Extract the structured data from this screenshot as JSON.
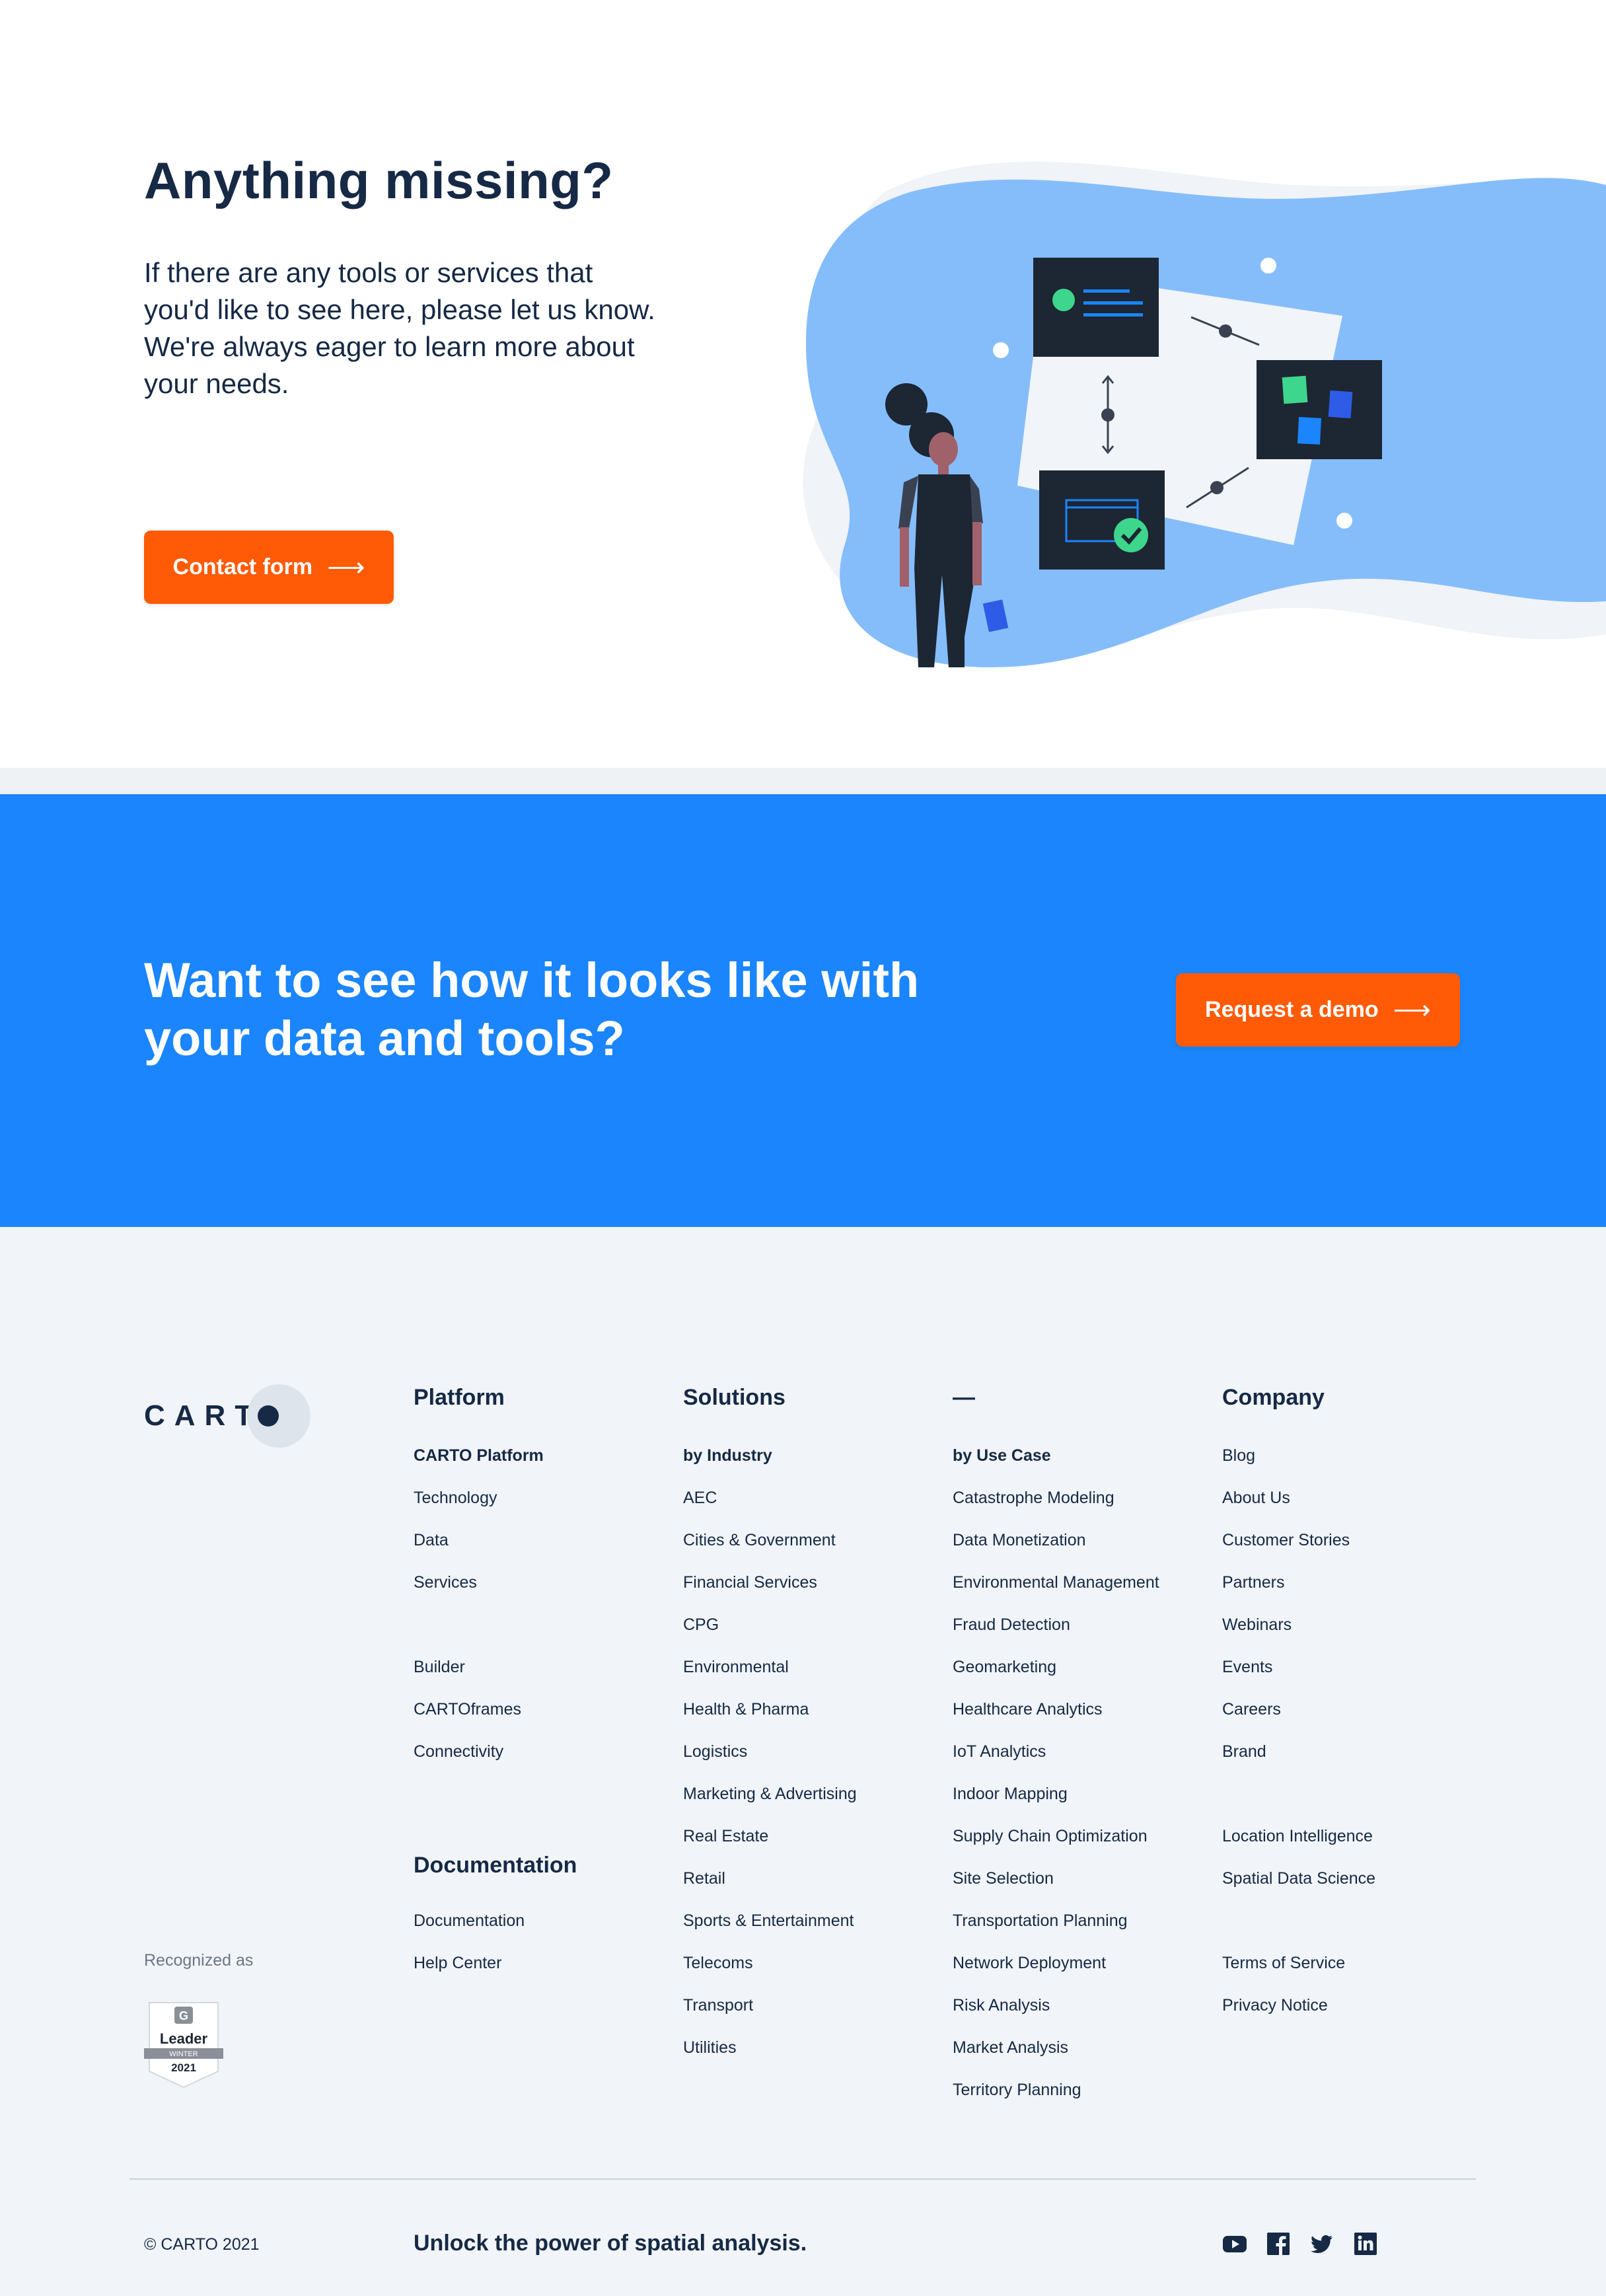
{
  "hero": {
    "title": "Anything missing?",
    "text": "If there are any tools or services that you'd like to see here, please let us know. We're always eager to learn more about your needs.",
    "button_label": "Contact form",
    "button_arrow": "⟶"
  },
  "cta": {
    "title": "Want to see how it looks like with your data and tools?",
    "button_label": "Request a demo",
    "button_arrow": "⟶"
  },
  "footer": {
    "logo_text": "CART",
    "columns": [
      {
        "heading": "Platform",
        "items": [
          "CARTO Platform",
          "Technology",
          "Data",
          "Services",
          "",
          "Builder",
          "CARTOframes",
          "Connectivity"
        ]
      },
      {
        "heading": "Solutions",
        "items": [
          "by Industry",
          "AEC",
          "Cities & Government",
          "Financial Services",
          "CPG",
          "Environmental",
          "Health & Pharma",
          "Logistics",
          "Marketing & Advertising",
          "Real Estate",
          "Retail",
          "Sports & Entertainment",
          "Telecoms",
          "Transport",
          "Utilities"
        ]
      },
      {
        "heading": "—",
        "items": [
          "by Use Case",
          "Catastrophe Modeling",
          "Data Monetization",
          "Environmental Management",
          "Fraud Detection",
          "Geomarketing",
          "Healthcare Analytics",
          "IoT Analytics",
          "Indoor Mapping",
          "Supply Chain Optimization",
          "Site Selection",
          "Transportation Planning",
          "Network Deployment",
          "Risk Analysis",
          "Market Analysis",
          "Territory Planning"
        ]
      },
      {
        "heading": "Company",
        "items": [
          "Blog",
          "About Us",
          "Customer Stories",
          "Partners",
          "Webinars",
          "Events",
          "Careers",
          "Brand",
          "",
          "Location Intelligence",
          "Spatial Data Science",
          "",
          "Terms of Service",
          "Privacy Notice"
        ]
      }
    ],
    "documentation": {
      "heading": "Documentation",
      "items": [
        "Documentation",
        "Help Center"
      ]
    },
    "recognized_label": "Recognized as",
    "badge": {
      "g2": "G",
      "title": "Leader",
      "season": "WINTER",
      "year": "2021"
    },
    "copyright": "© CARTO 2021",
    "tagline": "Unlock the power of spatial analysis.",
    "social": [
      "youtube-icon",
      "facebook-icon",
      "twitter-icon",
      "linkedin-icon"
    ]
  },
  "colors": {
    "navy": "#162945",
    "orange": "#ff5a05",
    "blue": "#1a85fc",
    "light_blue": "#85bdfb",
    "footer_bg": "#f1f4f8",
    "green": "#3ed68c"
  }
}
